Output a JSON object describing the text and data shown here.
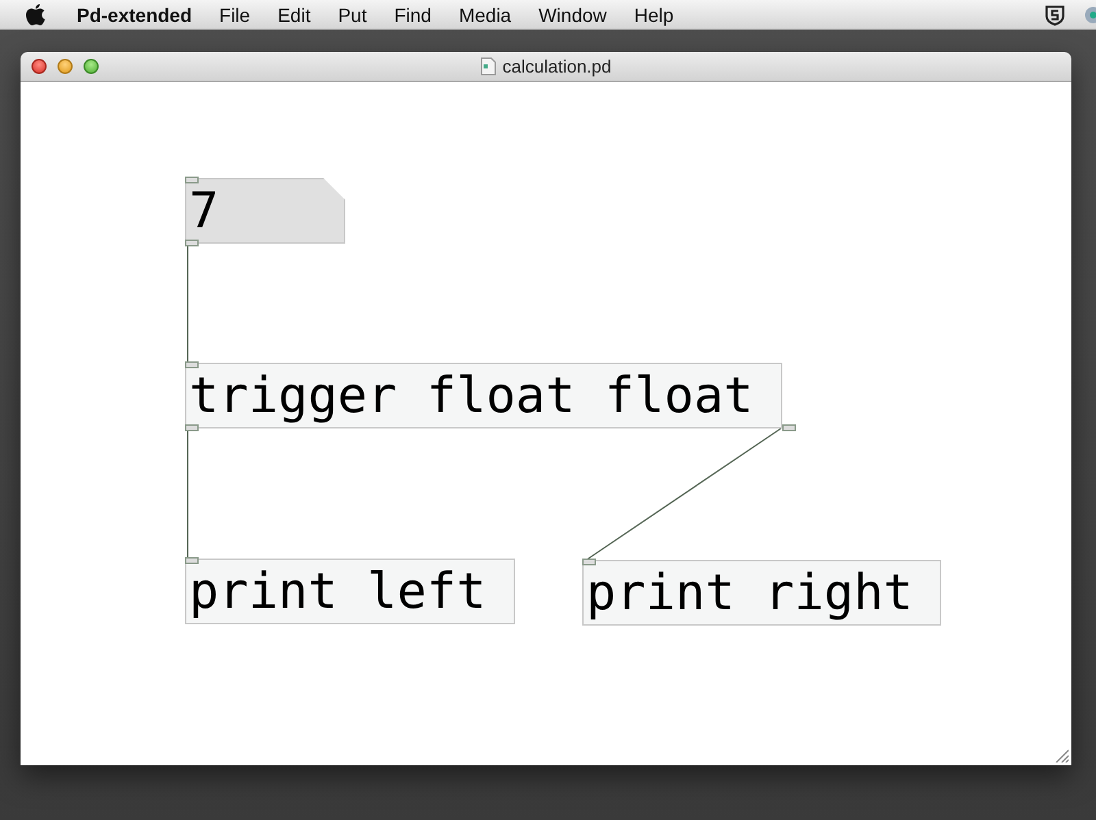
{
  "menu_bar": {
    "app_name": "Pd-extended",
    "items": [
      "File",
      "Edit",
      "Put",
      "Find",
      "Media",
      "Window",
      "Help"
    ]
  },
  "window": {
    "title": "calculation.pd"
  },
  "canvas": {
    "boxes": [
      {
        "kind": "number",
        "text": "7"
      },
      {
        "kind": "object",
        "text": "trigger float float"
      },
      {
        "kind": "object",
        "text": "print left"
      },
      {
        "kind": "object",
        "text": "print right"
      }
    ]
  }
}
